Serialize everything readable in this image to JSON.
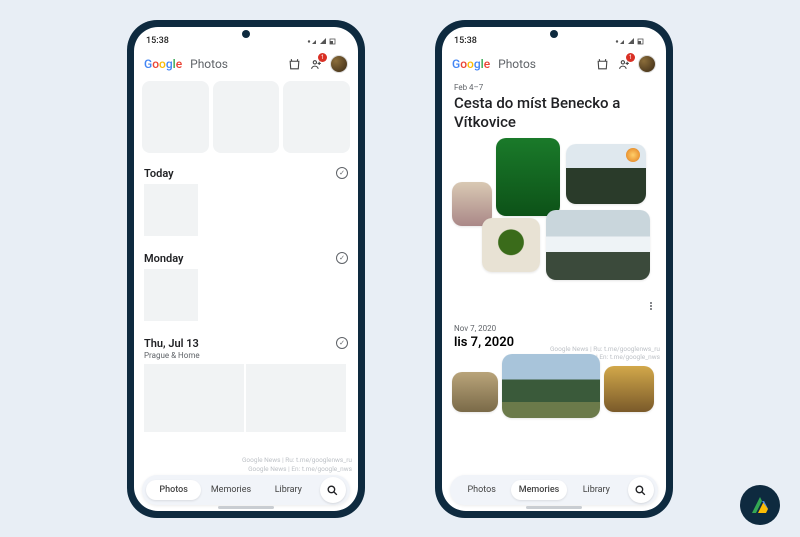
{
  "status": {
    "time": "15:38",
    "icons": "✽ ▾ ◢ ▯"
  },
  "header": {
    "logo_photos": "Photos",
    "badge_count": "1"
  },
  "left": {
    "sections": [
      {
        "title": "Today",
        "sub": ""
      },
      {
        "title": "Monday",
        "sub": ""
      },
      {
        "title": "Thu, Jul 13",
        "sub": "Prague & Home"
      }
    ],
    "watermark_line1": "Google News | Ru: t.me/googlenws_ru",
    "watermark_line2": "Google News | En: t.me/google_nws",
    "nav": {
      "photos": "Photos",
      "memories": "Memories",
      "library": "Library",
      "active": "photos"
    }
  },
  "right": {
    "date_range": "Feb 4–7",
    "title": "Cesta do míst Benecko a Vítkovice",
    "watermark_line1": "Google News | Ru: t.me/googlenws_ru",
    "watermark_line2": "Google News | En: t.me/google_nws",
    "sec2_date": "Nov 7, 2020",
    "sec2_title": "lis 7, 2020",
    "nav": {
      "photos": "Photos",
      "memories": "Memories",
      "library": "Library",
      "active": "memories"
    }
  }
}
